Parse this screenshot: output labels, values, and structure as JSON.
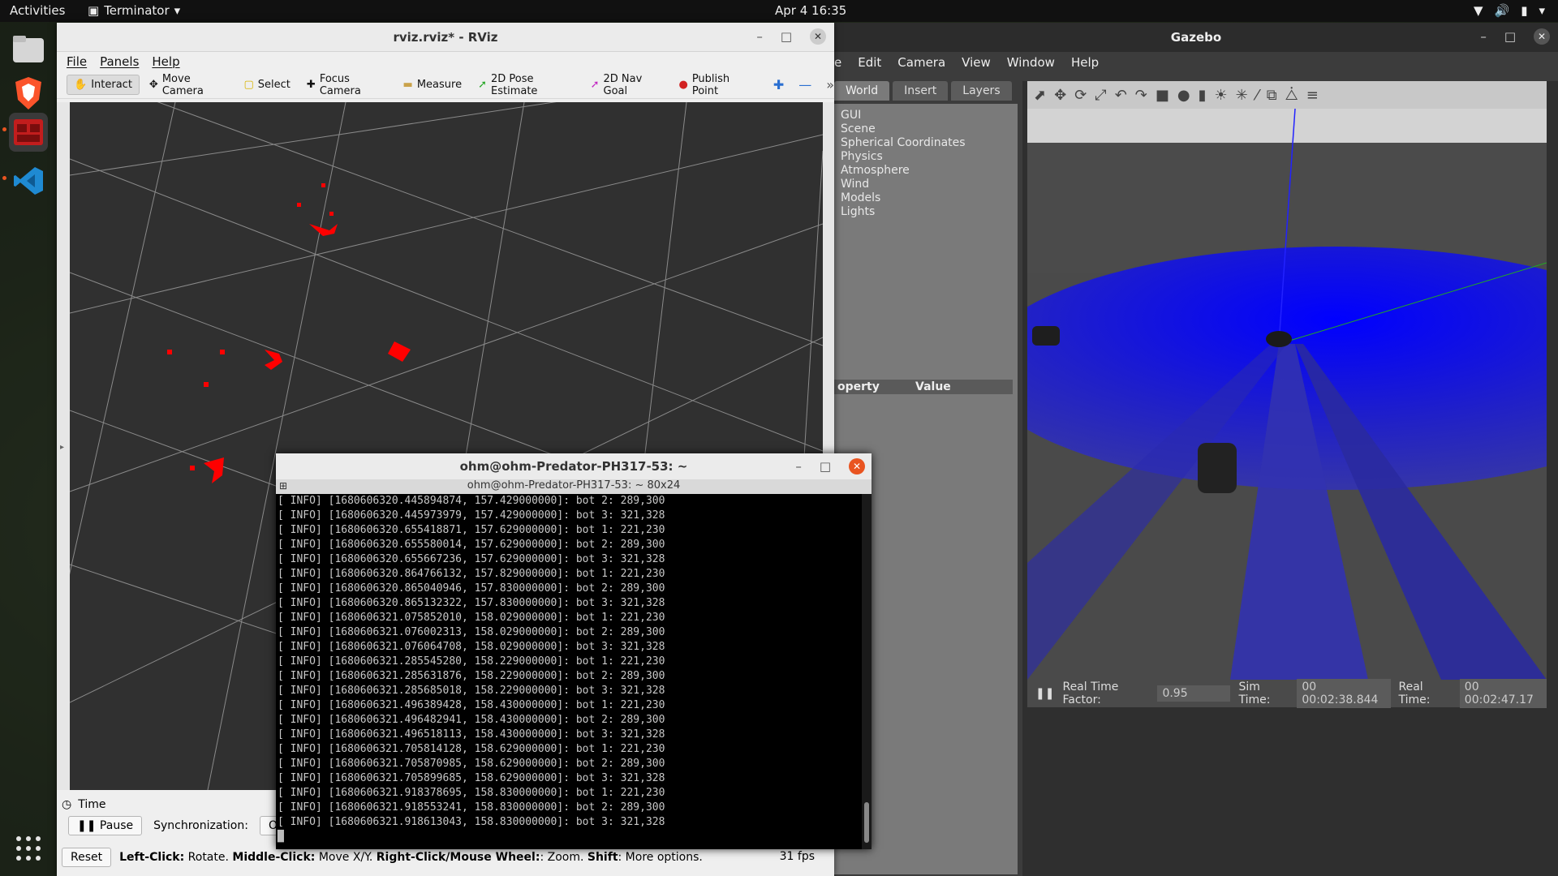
{
  "topbar": {
    "activities": "Activities",
    "app_name": "Terminator",
    "clock": "Apr 4  16:35"
  },
  "dock": {
    "items": [
      "files-icon",
      "brave-browser-icon",
      "terminator-icon",
      "vscode-icon",
      "app-grid-icon"
    ]
  },
  "rviz": {
    "title": "rviz.rviz* - RViz",
    "menu": [
      "File",
      "Panels",
      "Help"
    ],
    "tools": [
      {
        "label": "Interact",
        "icon": "hand-icon",
        "color": "#444444"
      },
      {
        "label": "Move Camera",
        "icon": "move-icon",
        "color": "#444444"
      },
      {
        "label": "Select",
        "icon": "select-icon",
        "color": "#d8b400"
      },
      {
        "label": "Focus Camera",
        "icon": "focus-icon",
        "color": "#444444"
      },
      {
        "label": "Measure",
        "icon": "ruler-icon",
        "color": "#c9a24a"
      },
      {
        "label": "2D Pose Estimate",
        "icon": "pose-arrow-icon",
        "color": "#27a827"
      },
      {
        "label": "2D Nav Goal",
        "icon": "goal-arrow-icon",
        "color": "#c227c2"
      },
      {
        "label": "Publish Point",
        "icon": "pin-icon",
        "color": "#d22222"
      }
    ],
    "time_panel": {
      "header": "Time",
      "pause": "Pause",
      "sync_label": "Synchronization:",
      "sync_value": "Off",
      "reset": "Reset"
    },
    "status": {
      "left_click_b": "Left-Click:",
      "left_click": "Rotate.",
      "middle_click_b": "Middle-Click:",
      "middle_click": "Move X/Y.",
      "right_click_b": "Right-Click/Mouse Wheel:",
      "right_click": ": Zoom.",
      "shift_b": "Shift",
      "shift": ": More options.",
      "fps": "31 fps"
    }
  },
  "gazebo": {
    "title": "Gazebo",
    "menu": [
      "e",
      "Edit",
      "Camera",
      "View",
      "Window",
      "Help"
    ],
    "tabs": [
      "World",
      "Insert",
      "Layers"
    ],
    "tree": [
      "GUI",
      "Scene",
      "Spherical Coordinates",
      "Physics",
      "Atmosphere",
      "Wind",
      "Models",
      "Lights"
    ],
    "prop_header": {
      "property": "operty",
      "value": "Value"
    },
    "bottom": {
      "rtf_label": "Real Time Factor:",
      "rtf_value": "0.95",
      "sim_label": "Sim Time:",
      "sim_value": "00 00:02:38.844",
      "real_label": "Real Time:",
      "real_value": "00 00:02:47.17"
    }
  },
  "terminal": {
    "title": "ohm@ohm-Predator-PH317-53: ~",
    "subtitle": "ohm@ohm-Predator-PH317-53: ~ 80x24",
    "lines": [
      "[ INFO] [1680606320.445894874, 157.429000000]: bot 2: 289,300",
      "[ INFO] [1680606320.445973979, 157.429000000]: bot 3: 321,328",
      "[ INFO] [1680606320.655418871, 157.629000000]: bot 1: 221,230",
      "[ INFO] [1680606320.655580014, 157.629000000]: bot 2: 289,300",
      "[ INFO] [1680606320.655667236, 157.629000000]: bot 3: 321,328",
      "[ INFO] [1680606320.864766132, 157.829000000]: bot 1: 221,230",
      "[ INFO] [1680606320.865040946, 157.830000000]: bot 2: 289,300",
      "[ INFO] [1680606320.865132322, 157.830000000]: bot 3: 321,328",
      "[ INFO] [1680606321.075852010, 158.029000000]: bot 1: 221,230",
      "[ INFO] [1680606321.076002313, 158.029000000]: bot 2: 289,300",
      "[ INFO] [1680606321.076064708, 158.029000000]: bot 3: 321,328",
      "[ INFO] [1680606321.285545280, 158.229000000]: bot 1: 221,230",
      "[ INFO] [1680606321.285631876, 158.229000000]: bot 2: 289,300",
      "[ INFO] [1680606321.285685018, 158.229000000]: bot 3: 321,328",
      "[ INFO] [1680606321.496389428, 158.430000000]: bot 1: 221,230",
      "[ INFO] [1680606321.496482941, 158.430000000]: bot 2: 289,300",
      "[ INFO] [1680606321.496518113, 158.430000000]: bot 3: 321,328",
      "[ INFO] [1680606321.705814128, 158.629000000]: bot 1: 221,230",
      "[ INFO] [1680606321.705870985, 158.629000000]: bot 2: 289,300",
      "[ INFO] [1680606321.705899685, 158.629000000]: bot 3: 321,328",
      "[ INFO] [1680606321.918378695, 158.830000000]: bot 1: 221,230",
      "[ INFO] [1680606321.918553241, 158.830000000]: bot 2: 289,300",
      "[ INFO] [1680606321.918613043, 158.830000000]: bot 3: 321,328"
    ]
  },
  "colors": {
    "ubuntu_orange": "#e95420",
    "laser_blue": "#1414ff",
    "marker_red": "#ff0000"
  }
}
